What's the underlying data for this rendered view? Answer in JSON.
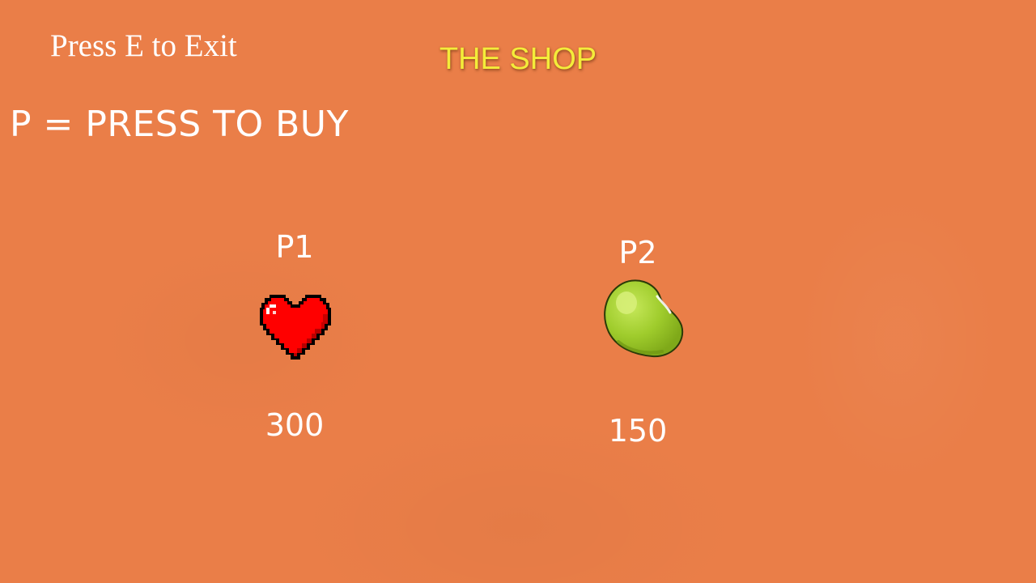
{
  "screen": {
    "exit_hint": "Press E to Exit",
    "title": "THE SHOP",
    "buy_hint": "P = PRESS TO BUY",
    "background_color": "#ea7e48",
    "title_color": "#f4ec3a"
  },
  "items": [
    {
      "key": "P1",
      "icon": "heart-icon",
      "price": "300",
      "color": "#ff0000"
    },
    {
      "key": "P2",
      "icon": "jelly-bean-icon",
      "price": "150",
      "color": "#9acd32"
    }
  ]
}
